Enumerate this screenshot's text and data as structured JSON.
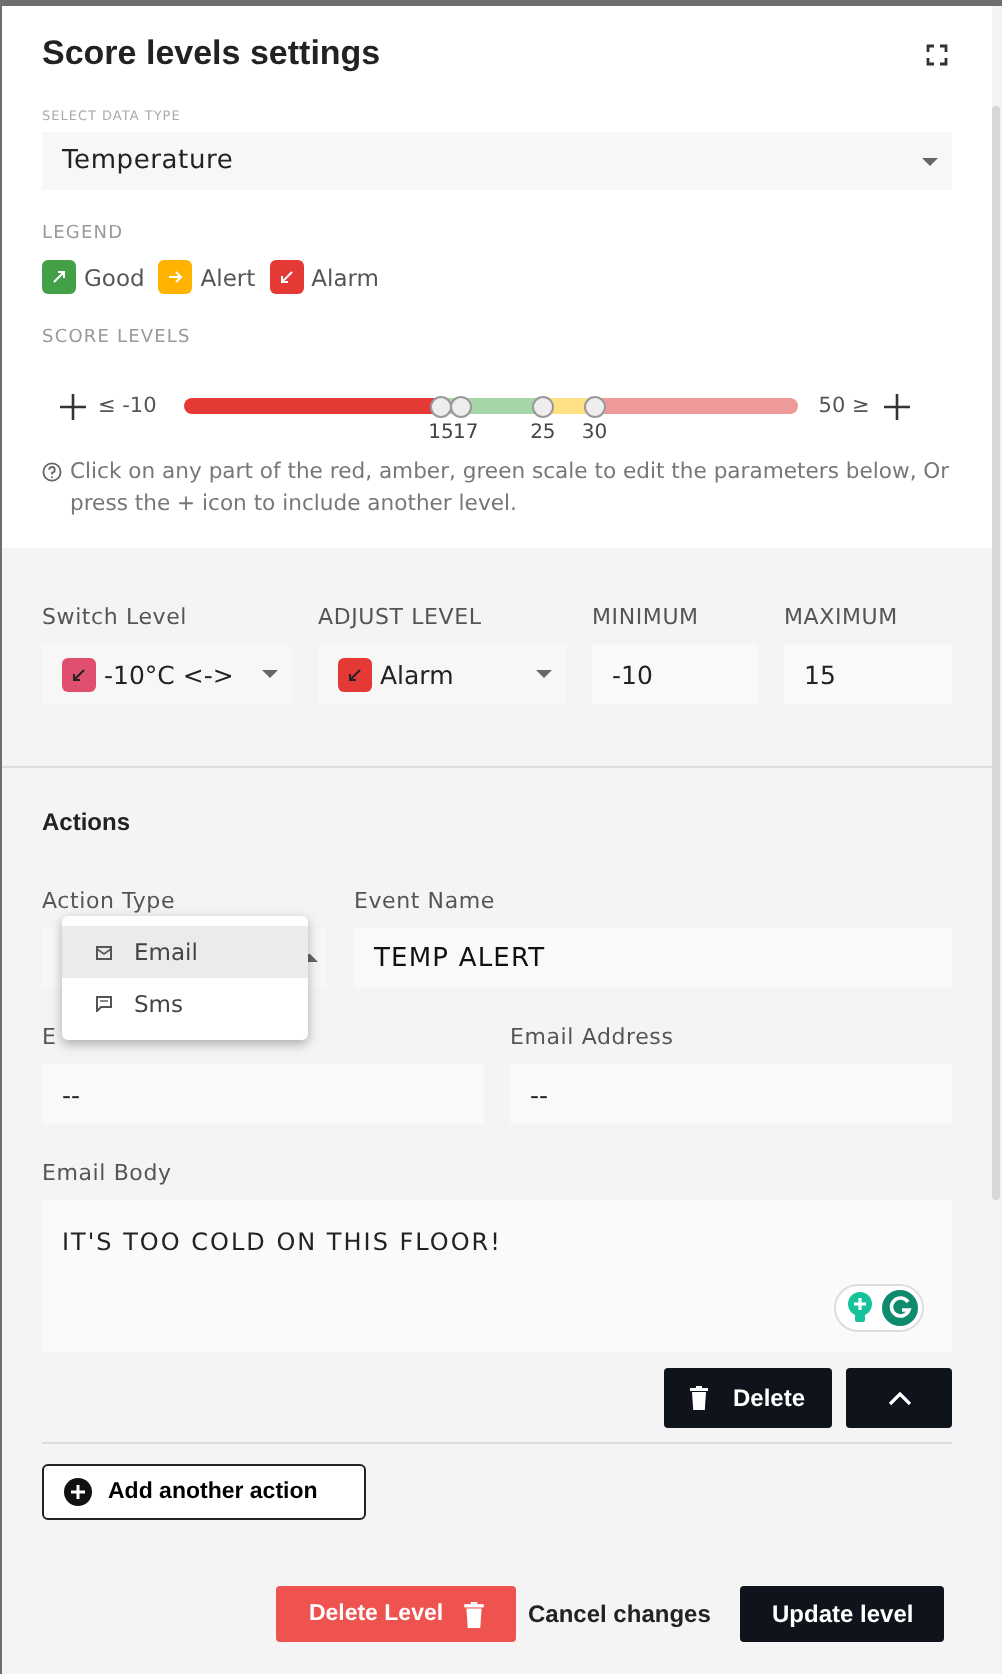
{
  "dialog": {
    "title": "Score levels settings"
  },
  "data_type": {
    "label": "SELECT DATA TYPE",
    "value": "Temperature"
  },
  "legend": {
    "label": "LEGEND",
    "items": [
      {
        "kind": "good",
        "label": "Good",
        "color": "#43a047"
      },
      {
        "kind": "alert",
        "label": "Alert",
        "color": "#ffb300"
      },
      {
        "kind": "alarm",
        "label": "Alarm",
        "color": "#e53935"
      }
    ]
  },
  "score_levels": {
    "label": "SCORE LEVELS",
    "min_label": "≤ -10",
    "max_label": "50 ≥",
    "segments": [
      {
        "color": "#e53935"
      },
      {
        "color": "#a5d6a7"
      },
      {
        "color": "#ffe082"
      },
      {
        "color": "#ef9a9a"
      }
    ],
    "thresholds": [
      {
        "label": "15",
        "level": 0.417
      },
      {
        "label": "17",
        "level": 0.45
      },
      {
        "label": "25",
        "level": 0.583
      },
      {
        "label": "30",
        "level": 0.667
      }
    ],
    "help": "Click on any part of the red, amber, green scale to edit the parameters below, Or press the + icon to include another level."
  },
  "level_form": [
    {
      "kind": "select",
      "label": "Switch Level",
      "value": "-10°C <->",
      "color": "#e0506e"
    },
    {
      "kind": "select",
      "label": "ADJUST LEVEL",
      "value": "Alarm",
      "color": "#e53935"
    },
    {
      "kind": "input",
      "label": "MINIMUM",
      "value": "-10"
    },
    {
      "kind": "input",
      "label": "MAXIMUM",
      "value": "15"
    }
  ],
  "actions": {
    "title": "Actions",
    "action_type": {
      "label": "Action Type",
      "menu": [
        {
          "kind": "email",
          "label": "Email",
          "selected": true
        },
        {
          "kind": "sms",
          "label": "Sms",
          "selected": false
        }
      ]
    },
    "event_name": {
      "label": "Event Name",
      "value": "TEMP ALERT"
    },
    "fields": [
      {
        "label": "E",
        "value": "--"
      },
      {
        "label": "Email Address",
        "value": "--"
      }
    ],
    "email_body": {
      "label": "Email Body",
      "value": "IT'S TOO COLD ON THIS FLOOR!"
    },
    "delete_button": "Delete",
    "add_button": "Add another action"
  },
  "footer": {
    "delete_level": "Delete Level",
    "cancel": "Cancel changes",
    "update": "Update level"
  }
}
